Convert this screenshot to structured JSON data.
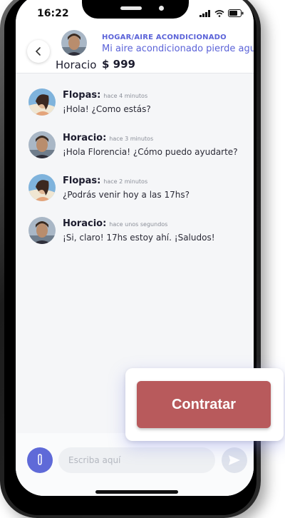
{
  "status_bar": {
    "time": "16:22"
  },
  "header": {
    "back_icon": "chevron-left-icon",
    "user_name": "Horacio",
    "category": "HOGAR/AIRE ACONDICIONADO",
    "title": "Mi aire acondicionado pierde agua",
    "price": "$ 999"
  },
  "messages": [
    {
      "author": "Flopas:",
      "time": "hace 4 minutos",
      "text": "¡Hola! ¿Como estás?",
      "avatar": "female"
    },
    {
      "author": "Horacio:",
      "time": "hace 3 minutos",
      "text": "¡Hola Florencia! ¿Cómo puedo ayudarte?",
      "avatar": "male"
    },
    {
      "author": "Flopas:",
      "time": "hace 2 minutos",
      "text": "¿Podrás venir hoy a las 17hs?",
      "avatar": "female"
    },
    {
      "author": "Horacio:",
      "time": "hace unos segundos",
      "text": "¡Si, claro! 17hs estoy ahí. ¡Saludos!",
      "avatar": "male"
    }
  ],
  "composer": {
    "placeholder": "Escriba aquí",
    "attach_icon": "paperclip-icon",
    "send_icon": "send-icon"
  },
  "cta": {
    "label": "Contratar",
    "color": "#b85a5c"
  },
  "colors": {
    "accent": "#5b63d8",
    "cta": "#b85a5c"
  }
}
